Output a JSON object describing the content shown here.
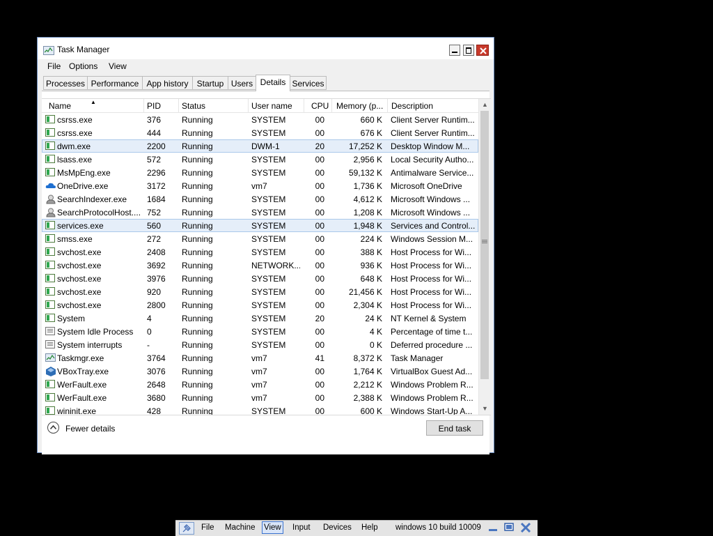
{
  "window": {
    "title": "Task Manager",
    "menu": [
      "File",
      "Options",
      "View"
    ],
    "tabs": [
      "Processes",
      "Performance",
      "App history",
      "Startup",
      "Users",
      "Details",
      "Services"
    ],
    "active_tab": "Details"
  },
  "table": {
    "columns": [
      "Name",
      "PID",
      "Status",
      "User name",
      "CPU",
      "Memory (p...",
      "Description"
    ],
    "sorted_by": "Name",
    "selected_rows": [
      "dwm.exe",
      "services.exe"
    ],
    "rows": [
      {
        "icon": "exe-icon",
        "name": "csrss.exe",
        "pid": "376",
        "status": "Running",
        "user": "SYSTEM",
        "cpu": "00",
        "mem": "660 K",
        "desc": "Client Server Runtim..."
      },
      {
        "icon": "exe-icon",
        "name": "csrss.exe",
        "pid": "444",
        "status": "Running",
        "user": "SYSTEM",
        "cpu": "00",
        "mem": "676 K",
        "desc": "Client Server Runtim..."
      },
      {
        "icon": "exe-icon",
        "name": "dwm.exe",
        "pid": "2200",
        "status": "Running",
        "user": "DWM-1",
        "cpu": "20",
        "mem": "17,252 K",
        "desc": "Desktop Window M..."
      },
      {
        "icon": "exe-icon",
        "name": "lsass.exe",
        "pid": "572",
        "status": "Running",
        "user": "SYSTEM",
        "cpu": "00",
        "mem": "2,956 K",
        "desc": "Local Security Autho..."
      },
      {
        "icon": "exe-icon",
        "name": "MsMpEng.exe",
        "pid": "2296",
        "status": "Running",
        "user": "SYSTEM",
        "cpu": "00",
        "mem": "59,132 K",
        "desc": "Antimalware Service..."
      },
      {
        "icon": "onedrive-icon",
        "name": "OneDrive.exe",
        "pid": "3172",
        "status": "Running",
        "user": "vm7",
        "cpu": "00",
        "mem": "1,736 K",
        "desc": "Microsoft OneDrive"
      },
      {
        "icon": "search-indexer-icon",
        "name": "SearchIndexer.exe",
        "pid": "1684",
        "status": "Running",
        "user": "SYSTEM",
        "cpu": "00",
        "mem": "4,612 K",
        "desc": "Microsoft Windows ..."
      },
      {
        "icon": "search-indexer-icon",
        "name": "SearchProtocolHost....",
        "pid": "752",
        "status": "Running",
        "user": "SYSTEM",
        "cpu": "00",
        "mem": "1,208 K",
        "desc": "Microsoft Windows ..."
      },
      {
        "icon": "exe-icon",
        "name": "services.exe",
        "pid": "560",
        "status": "Running",
        "user": "SYSTEM",
        "cpu": "00",
        "mem": "1,948 K",
        "desc": "Services and Control..."
      },
      {
        "icon": "exe-icon",
        "name": "smss.exe",
        "pid": "272",
        "status": "Running",
        "user": "SYSTEM",
        "cpu": "00",
        "mem": "224 K",
        "desc": "Windows Session M..."
      },
      {
        "icon": "exe-icon",
        "name": "svchost.exe",
        "pid": "2408",
        "status": "Running",
        "user": "SYSTEM",
        "cpu": "00",
        "mem": "388 K",
        "desc": "Host Process for Wi..."
      },
      {
        "icon": "exe-icon",
        "name": "svchost.exe",
        "pid": "3692",
        "status": "Running",
        "user": "NETWORK...",
        "cpu": "00",
        "mem": "936 K",
        "desc": "Host Process for Wi..."
      },
      {
        "icon": "exe-icon",
        "name": "svchost.exe",
        "pid": "3976",
        "status": "Running",
        "user": "SYSTEM",
        "cpu": "00",
        "mem": "648 K",
        "desc": "Host Process for Wi..."
      },
      {
        "icon": "exe-icon",
        "name": "svchost.exe",
        "pid": "920",
        "status": "Running",
        "user": "SYSTEM",
        "cpu": "00",
        "mem": "21,456 K",
        "desc": "Host Process for Wi..."
      },
      {
        "icon": "exe-icon",
        "name": "svchost.exe",
        "pid": "2800",
        "status": "Running",
        "user": "SYSTEM",
        "cpu": "00",
        "mem": "2,304 K",
        "desc": "Host Process for Wi..."
      },
      {
        "icon": "exe-icon",
        "name": "System",
        "pid": "4",
        "status": "Running",
        "user": "SYSTEM",
        "cpu": "20",
        "mem": "24 K",
        "desc": "NT Kernel & System"
      },
      {
        "icon": "system-icon",
        "name": "System Idle Process",
        "pid": "0",
        "status": "Running",
        "user": "SYSTEM",
        "cpu": "00",
        "mem": "4 K",
        "desc": "Percentage of time t..."
      },
      {
        "icon": "system-icon",
        "name": "System interrupts",
        "pid": "-",
        "status": "Running",
        "user": "SYSTEM",
        "cpu": "00",
        "mem": "0 K",
        "desc": "Deferred procedure ..."
      },
      {
        "icon": "task-manager-icon",
        "name": "Taskmgr.exe",
        "pid": "3764",
        "status": "Running",
        "user": "vm7",
        "cpu": "41",
        "mem": "8,372 K",
        "desc": "Task Manager"
      },
      {
        "icon": "virtualbox-icon",
        "name": "VBoxTray.exe",
        "pid": "3076",
        "status": "Running",
        "user": "vm7",
        "cpu": "00",
        "mem": "1,764 K",
        "desc": "VirtualBox Guest Ad..."
      },
      {
        "icon": "exe-icon",
        "name": "WerFault.exe",
        "pid": "2648",
        "status": "Running",
        "user": "vm7",
        "cpu": "00",
        "mem": "2,212 K",
        "desc": "Windows Problem R..."
      },
      {
        "icon": "exe-icon",
        "name": "WerFault.exe",
        "pid": "3680",
        "status": "Running",
        "user": "vm7",
        "cpu": "00",
        "mem": "2,388 K",
        "desc": "Windows Problem R..."
      },
      {
        "icon": "exe-icon",
        "name": "wininit.exe",
        "pid": "428",
        "status": "Running",
        "user": "SYSTEM",
        "cpu": "00",
        "mem": "600 K",
        "desc": "Windows Start-Up A..."
      }
    ]
  },
  "footer": {
    "fewer_details": "Fewer details",
    "end_task": "End task"
  },
  "vbox_bar": {
    "menus": [
      "File",
      "Machine",
      "View",
      "Input",
      "Devices",
      "Help"
    ],
    "active_menu": "View",
    "vm_name": "windows 10 build 10009"
  },
  "colors": {
    "background": "#000000",
    "selection": "#e5eef9",
    "close_button": "#c8392b"
  }
}
